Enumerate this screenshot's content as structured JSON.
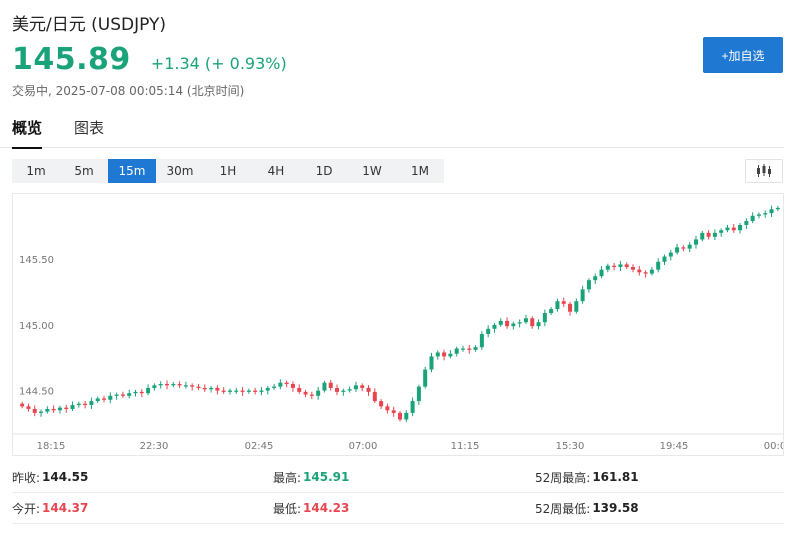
{
  "header": {
    "title": "美元/日元 (USDJPY)",
    "price": "145.89",
    "change": "+1.34 (+ 0.93%)",
    "status": "交易中, 2025-07-08 00:05:14 (北京时间)",
    "watch_label": "+加自选"
  },
  "tabs": [
    "概览",
    "图表"
  ],
  "intervals": [
    "1m",
    "5m",
    "15m",
    "30m",
    "1H",
    "4H",
    "1D",
    "1W",
    "1M"
  ],
  "active_interval": "15m",
  "colors": {
    "up": "#1aa37a",
    "down": "#e8464f",
    "accent": "#1f78d1"
  },
  "stats": {
    "prev_close_label": "昨收:",
    "prev_close": "144.55",
    "high_label": "最高:",
    "high": "145.91",
    "high52_label": "52周最高:",
    "high52": "161.81",
    "open_label": "今开:",
    "open": "144.37",
    "low_label": "最低:",
    "low": "144.23",
    "low52_label": "52周最低:",
    "low52": "139.58"
  },
  "chart_data": {
    "type": "candlestick",
    "interval": "15m",
    "y_ticks": [
      144.5,
      145.0,
      145.5
    ],
    "y_tick_labels": [
      "144.50",
      "145.00",
      "145.50"
    ],
    "ylim": [
      144.2,
      145.95
    ],
    "x_tick_labels": [
      "18:15",
      "22:30",
      "02:45",
      "07:00",
      "11:15",
      "15:30",
      "19:45",
      "00:0"
    ],
    "grid": false,
    "closes": [
      144.38,
      144.36,
      144.33,
      144.34,
      144.36,
      144.35,
      144.37,
      144.36,
      144.39,
      144.4,
      144.39,
      144.42,
      144.44,
      144.43,
      144.46,
      144.47,
      144.46,
      144.48,
      144.49,
      144.48,
      144.52,
      144.54,
      144.55,
      144.54,
      144.55,
      144.54,
      144.54,
      144.53,
      144.52,
      144.51,
      144.52,
      144.5,
      144.49,
      144.5,
      144.5,
      144.49,
      144.5,
      144.49,
      144.5,
      144.52,
      144.53,
      144.56,
      144.55,
      144.52,
      144.49,
      144.47,
      144.46,
      144.5,
      144.56,
      144.52,
      144.49,
      144.5,
      144.51,
      144.54,
      144.52,
      144.49,
      144.42,
      144.38,
      144.35,
      144.33,
      144.28,
      144.33,
      144.42,
      144.53,
      144.66,
      144.76,
      144.79,
      144.76,
      144.78,
      144.82,
      144.82,
      144.81,
      144.83,
      144.93,
      144.97,
      145.0,
      145.03,
      144.99,
      145.01,
      145.02,
      145.05,
      144.99,
      145.02,
      145.09,
      145.12,
      145.18,
      145.16,
      145.1,
      145.18,
      145.27,
      145.34,
      145.37,
      145.42,
      145.45,
      145.44,
      145.46,
      145.44,
      145.42,
      145.4,
      145.39,
      145.42,
      145.48,
      145.52,
      145.55,
      145.59,
      145.58,
      145.61,
      145.65,
      145.7,
      145.67,
      145.7,
      145.72,
      145.74,
      145.72,
      145.76,
      145.79,
      145.83,
      145.84,
      145.85,
      145.88,
      145.89
    ]
  }
}
